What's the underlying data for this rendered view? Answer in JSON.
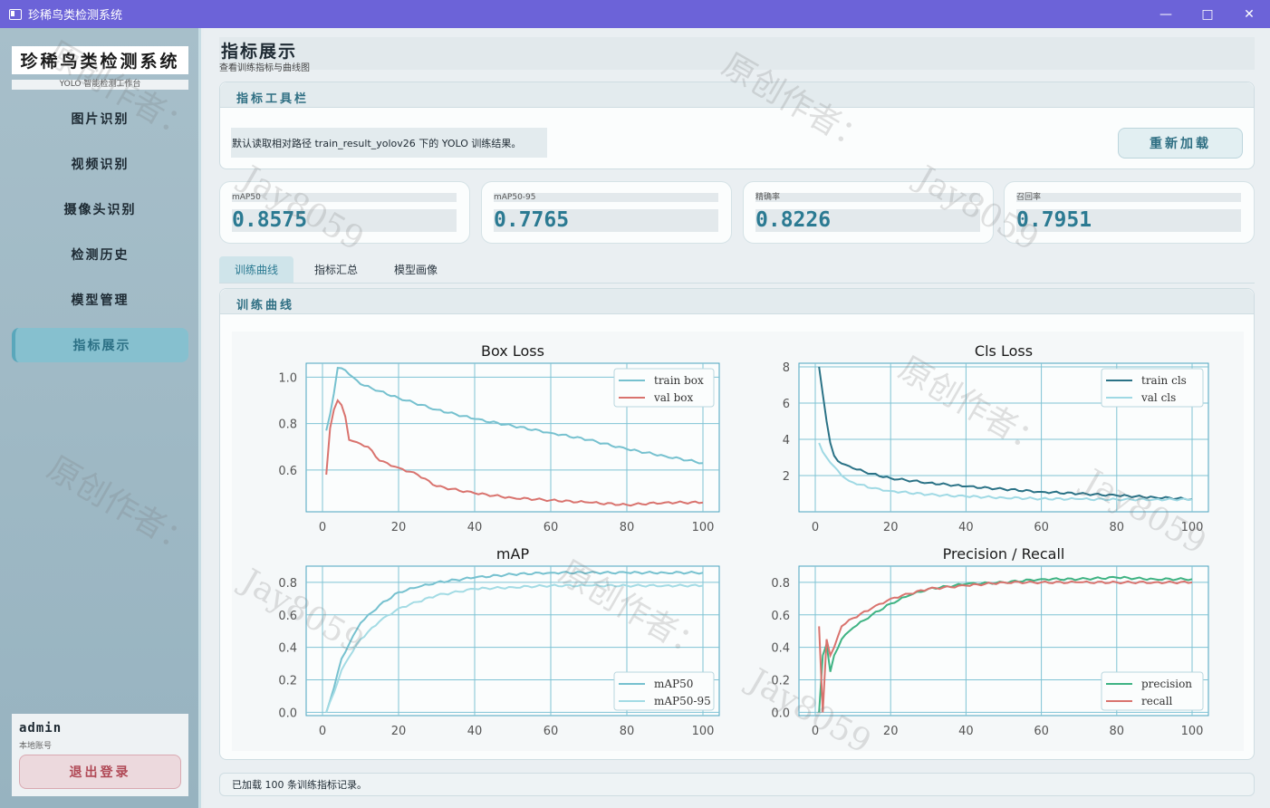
{
  "window": {
    "title": "珍稀鸟类检测系统"
  },
  "sidebar": {
    "brand_title": "珍稀鸟类检测系统",
    "brand_sub": "YOLO 智能检测工作台",
    "items": [
      {
        "label": "图片识别"
      },
      {
        "label": "视频识别"
      },
      {
        "label": "摄像头识别"
      },
      {
        "label": "检测历史"
      },
      {
        "label": "模型管理"
      },
      {
        "label": "指标展示"
      }
    ],
    "user": {
      "name": "admin",
      "type": "本地账号",
      "logout_label": "退出登录"
    }
  },
  "page": {
    "title": "指标展示",
    "subtitle": "查看训练指标与曲线图"
  },
  "toolbar": {
    "header": "指标工具栏",
    "note": "默认读取相对路径 train_result_yolov26 下的 YOLO 训练结果。",
    "reload_label": "重新加载"
  },
  "metrics": [
    {
      "label": "mAP50",
      "value": "0.8575"
    },
    {
      "label": "mAP50-95",
      "value": "0.7765"
    },
    {
      "label": "精确率",
      "value": "0.8226"
    },
    {
      "label": "召回率",
      "value": "0.7951"
    }
  ],
  "tabs": [
    {
      "label": "训练曲线"
    },
    {
      "label": "指标汇总"
    },
    {
      "label": "模型画像"
    }
  ],
  "curves_panel": {
    "header": "训练曲线"
  },
  "status": {
    "text": "已加载 100 条训练指标记录。"
  },
  "watermarks": {
    "cn": "原创作者：",
    "en": "Jay8059"
  },
  "colors": {
    "titlebar": "#6c63d8",
    "accent": "#2b7a92",
    "train_box": "#76c1cf",
    "val_box": "#d9736e",
    "train_cls": "#2a7286",
    "val_cls": "#9fd9e4",
    "map50": "#76c1cf",
    "map50_95": "#a3dbe4",
    "precision": "#3fb383",
    "recall": "#d9736e"
  },
  "chart_data": [
    {
      "type": "line",
      "title": "Box Loss",
      "xlim": [
        0,
        100
      ],
      "ylim": [
        0.42,
        1.06
      ],
      "yticks": [
        0.6,
        0.8,
        1.0
      ],
      "xticks": [
        0,
        20,
        40,
        60,
        80,
        100
      ],
      "grid": true,
      "legend": "top-right",
      "series": [
        {
          "name": "train box",
          "color": "#76c1cf",
          "keypoints": [
            [
              1,
              0.77
            ],
            [
              2,
              0.84
            ],
            [
              3,
              0.93
            ],
            [
              4,
              1.04
            ],
            [
              6,
              1.03
            ],
            [
              8,
              1.0
            ],
            [
              10,
              0.97
            ],
            [
              15,
              0.94
            ],
            [
              20,
              0.91
            ],
            [
              30,
              0.86
            ],
            [
              40,
              0.82
            ],
            [
              50,
              0.79
            ],
            [
              60,
              0.76
            ],
            [
              70,
              0.73
            ],
            [
              80,
              0.69
            ],
            [
              90,
              0.66
            ],
            [
              100,
              0.63
            ]
          ]
        },
        {
          "name": "val box",
          "color": "#d9736e",
          "keypoints": [
            [
              1,
              0.58
            ],
            [
              2,
              0.78
            ],
            [
              3,
              0.86
            ],
            [
              4,
              0.9
            ],
            [
              5,
              0.88
            ],
            [
              6,
              0.83
            ],
            [
              7,
              0.73
            ],
            [
              9,
              0.72
            ],
            [
              12,
              0.7
            ],
            [
              15,
              0.64
            ],
            [
              20,
              0.61
            ],
            [
              25,
              0.58
            ],
            [
              30,
              0.53
            ],
            [
              40,
              0.5
            ],
            [
              50,
              0.48
            ],
            [
              60,
              0.47
            ],
            [
              70,
              0.46
            ],
            [
              80,
              0.45
            ],
            [
              90,
              0.46
            ],
            [
              100,
              0.46
            ]
          ]
        }
      ]
    },
    {
      "type": "line",
      "title": "Cls Loss",
      "xlim": [
        0,
        100
      ],
      "ylim": [
        0.0,
        8.2
      ],
      "yticks": [
        2,
        4,
        6,
        8
      ],
      "xticks": [
        0,
        20,
        40,
        60,
        80,
        100
      ],
      "grid": true,
      "legend": "top-right",
      "series": [
        {
          "name": "train cls",
          "color": "#2a7286",
          "keypoints": [
            [
              1,
              8.0
            ],
            [
              2,
              6.5
            ],
            [
              3,
              5.0
            ],
            [
              4,
              3.8
            ],
            [
              5,
              3.1
            ],
            [
              6,
              2.8
            ],
            [
              8,
              2.6
            ],
            [
              10,
              2.4
            ],
            [
              15,
              2.1
            ],
            [
              20,
              1.85
            ],
            [
              30,
              1.6
            ],
            [
              40,
              1.4
            ],
            [
              50,
              1.25
            ],
            [
              60,
              1.1
            ],
            [
              70,
              1.0
            ],
            [
              80,
              0.9
            ],
            [
              90,
              0.8
            ],
            [
              100,
              0.7
            ]
          ]
        },
        {
          "name": "val cls",
          "color": "#9fd9e4",
          "keypoints": [
            [
              1,
              3.8
            ],
            [
              2,
              3.3
            ],
            [
              3,
              3.0
            ],
            [
              5,
              2.5
            ],
            [
              7,
              2.0
            ],
            [
              9,
              1.7
            ],
            [
              12,
              1.5
            ],
            [
              15,
              1.3
            ],
            [
              20,
              1.15
            ],
            [
              30,
              0.95
            ],
            [
              40,
              0.85
            ],
            [
              50,
              0.78
            ],
            [
              60,
              0.72
            ],
            [
              70,
              0.7
            ],
            [
              80,
              0.68
            ],
            [
              90,
              0.68
            ],
            [
              100,
              0.68
            ]
          ]
        }
      ]
    },
    {
      "type": "line",
      "title": "mAP",
      "xlim": [
        0,
        100
      ],
      "ylim": [
        -0.02,
        0.9
      ],
      "yticks": [
        0.0,
        0.2,
        0.4,
        0.6,
        0.8
      ],
      "xticks": [
        0,
        20,
        40,
        60,
        80,
        100
      ],
      "grid": true,
      "legend": "bottom-right",
      "series": [
        {
          "name": "mAP50",
          "color": "#76c1cf",
          "keypoints": [
            [
              1,
              0.0
            ],
            [
              3,
              0.15
            ],
            [
              5,
              0.33
            ],
            [
              7,
              0.42
            ],
            [
              10,
              0.55
            ],
            [
              15,
              0.66
            ],
            [
              20,
              0.74
            ],
            [
              25,
              0.77
            ],
            [
              30,
              0.8
            ],
            [
              40,
              0.83
            ],
            [
              50,
              0.85
            ],
            [
              60,
              0.86
            ],
            [
              70,
              0.86
            ],
            [
              80,
              0.86
            ],
            [
              90,
              0.86
            ],
            [
              100,
              0.86
            ]
          ]
        },
        {
          "name": "mAP50-95",
          "color": "#a3dbe4",
          "keypoints": [
            [
              1,
              0.0
            ],
            [
              3,
              0.12
            ],
            [
              5,
              0.26
            ],
            [
              7,
              0.34
            ],
            [
              10,
              0.45
            ],
            [
              15,
              0.56
            ],
            [
              20,
              0.64
            ],
            [
              25,
              0.68
            ],
            [
              30,
              0.72
            ],
            [
              40,
              0.76
            ],
            [
              50,
              0.77
            ],
            [
              60,
              0.78
            ],
            [
              70,
              0.78
            ],
            [
              80,
              0.78
            ],
            [
              90,
              0.78
            ],
            [
              100,
              0.78
            ]
          ]
        }
      ]
    },
    {
      "type": "line",
      "title": "Precision / Recall",
      "xlim": [
        0,
        100
      ],
      "ylim": [
        -0.02,
        0.9
      ],
      "yticks": [
        0.0,
        0.2,
        0.4,
        0.6,
        0.8
      ],
      "xticks": [
        0,
        20,
        40,
        60,
        80,
        100
      ],
      "grid": true,
      "legend": "bottom-right",
      "series": [
        {
          "name": "precision",
          "color": "#3fb383",
          "keypoints": [
            [
              1,
              0.0
            ],
            [
              2,
              0.35
            ],
            [
              3,
              0.42
            ],
            [
              4,
              0.25
            ],
            [
              5,
              0.35
            ],
            [
              7,
              0.45
            ],
            [
              10,
              0.52
            ],
            [
              15,
              0.6
            ],
            [
              20,
              0.67
            ],
            [
              25,
              0.72
            ],
            [
              30,
              0.76
            ],
            [
              40,
              0.79
            ],
            [
              50,
              0.8
            ],
            [
              60,
              0.82
            ],
            [
              70,
              0.82
            ],
            [
              80,
              0.83
            ],
            [
              90,
              0.82
            ],
            [
              100,
              0.82
            ]
          ]
        },
        {
          "name": "recall",
          "color": "#d9736e",
          "keypoints": [
            [
              1,
              0.53
            ],
            [
              2,
              0.0
            ],
            [
              3,
              0.45
            ],
            [
              4,
              0.35
            ],
            [
              5,
              0.4
            ],
            [
              7,
              0.53
            ],
            [
              10,
              0.58
            ],
            [
              15,
              0.64
            ],
            [
              20,
              0.7
            ],
            [
              25,
              0.73
            ],
            [
              30,
              0.76
            ],
            [
              40,
              0.78
            ],
            [
              50,
              0.8
            ],
            [
              60,
              0.8
            ],
            [
              70,
              0.8
            ],
            [
              80,
              0.8
            ],
            [
              90,
              0.8
            ],
            [
              100,
              0.8
            ]
          ]
        }
      ]
    }
  ]
}
